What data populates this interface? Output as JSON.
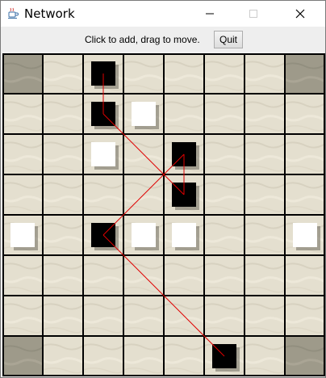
{
  "window": {
    "title": "Network",
    "app_icon": "java-coffee-cup-icon"
  },
  "toolbar": {
    "hint": "Click to add, drag to move.",
    "quit_label": "Quit"
  },
  "board": {
    "cols": 8,
    "rows": 8,
    "corner_squares": [
      [
        0,
        0
      ],
      [
        7,
        0
      ],
      [
        0,
        7
      ],
      [
        7,
        7
      ]
    ],
    "colors": {
      "cell": "#e4dfcf",
      "corner": "#9e9a8a",
      "grid": "#000000",
      "black_piece": "#000000",
      "white_piece": "#ffffff",
      "connection": "#e00000"
    },
    "pieces": [
      {
        "col": 2,
        "row": 0,
        "color": "black"
      },
      {
        "col": 2,
        "row": 1,
        "color": "black"
      },
      {
        "col": 3,
        "row": 1,
        "color": "white"
      },
      {
        "col": 2,
        "row": 2,
        "color": "white"
      },
      {
        "col": 4,
        "row": 2,
        "color": "black"
      },
      {
        "col": 4,
        "row": 3,
        "color": "black"
      },
      {
        "col": 0,
        "row": 4,
        "color": "white"
      },
      {
        "col": 2,
        "row": 4,
        "color": "black"
      },
      {
        "col": 3,
        "row": 4,
        "color": "white"
      },
      {
        "col": 4,
        "row": 4,
        "color": "white"
      },
      {
        "col": 7,
        "row": 4,
        "color": "white"
      },
      {
        "col": 5,
        "row": 7,
        "color": "black"
      }
    ],
    "network_path": [
      [
        2,
        0
      ],
      [
        2,
        1
      ],
      [
        4,
        3
      ],
      [
        4,
        2
      ],
      [
        2,
        4
      ],
      [
        5,
        7
      ]
    ]
  }
}
